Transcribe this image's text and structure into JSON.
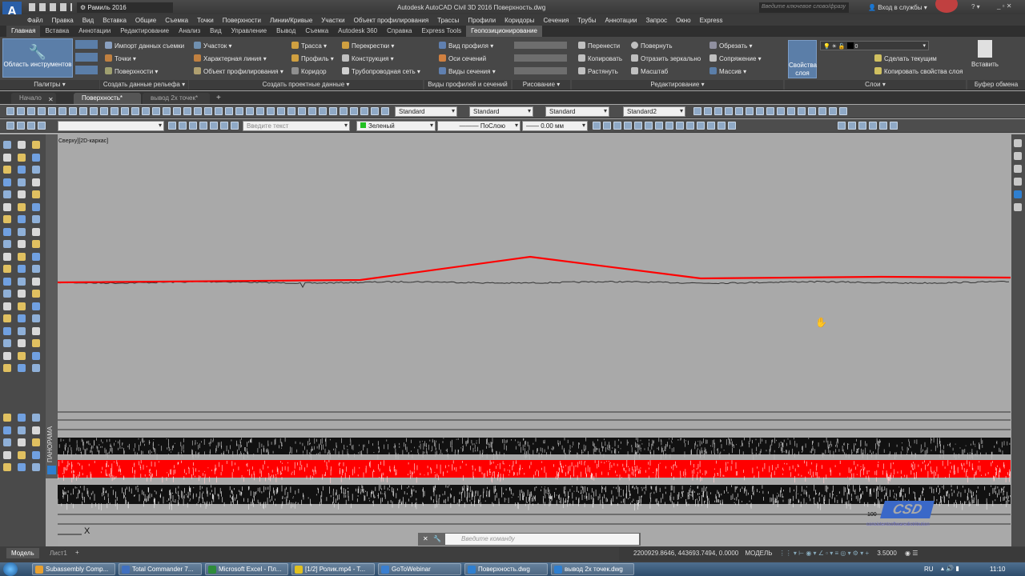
{
  "titlebar": {
    "workspace": "Рамиль 2016",
    "title": "Autodesk AutoCAD Civil 3D 2016   Поверхность.dwg",
    "search_placeholder": "Введите ключевое слово/фразу",
    "signin": "Вход в службы"
  },
  "menu": [
    "Файл",
    "Правка",
    "Вид",
    "Вставка",
    "Общие",
    "Съемка",
    "Точки",
    "Поверхности",
    "Линии/Кривые",
    "Участки",
    "Объект профилирования",
    "Трассы",
    "Профили",
    "Коридоры",
    "Сечения",
    "Трубы",
    "Аннотации",
    "Запрос",
    "Окно",
    "Express"
  ],
  "ribbon_tabs": [
    "Главная",
    "Вставка",
    "Аннотации",
    "Редактирование",
    "Анализ",
    "Вид",
    "Управление",
    "Вывод",
    "Съемка",
    "Autodesk 360",
    "Справка",
    "Express Tools",
    "Геопозиционирование"
  ],
  "ribbon": {
    "tool_area": "Область инструментов",
    "palettes": "Палитры ▾",
    "terrain": {
      "items": [
        "Импорт данных съемки",
        "Точки ▾",
        "Поверхности ▾"
      ],
      "label": "Создать данные рельефа ▾"
    },
    "design": {
      "items": [
        "Участок ▾",
        "Характерная линия ▾",
        "Объект профилирования ▾",
        "Трасса ▾",
        "Профиль ▾",
        "Коридор",
        "Перекрестки ▾",
        "Конструкция ▾",
        "Трубопроводная сеть ▾"
      ],
      "label": "Создать проектные данные ▾"
    },
    "profiles": {
      "items": [
        "Вид профиля ▾",
        "Оси сечений",
        "Виды сечения ▾"
      ],
      "label": "Виды профилей и сечений"
    },
    "draw": {
      "label": "Рисование ▾"
    },
    "modify": {
      "items": [
        "Перенести",
        "Копировать",
        "Растянуть",
        "Повернуть",
        "Отразить зеркально",
        "Масштаб",
        "Обрезать ▾",
        "Сопряжение ▾",
        "Массив ▾"
      ],
      "label": "Редактирование ▾"
    },
    "layers": {
      "props": "Свойства слоя",
      "current_layer": "0",
      "make_current": "Сделать текущим",
      "copy_props": "Копировать свойства слоя",
      "label": "Слои ▾"
    },
    "clipboard": {
      "paste": "Вставить",
      "label": "Буфер обмена"
    }
  },
  "file_tabs": [
    "Начало",
    "Поверхность*",
    "вывод 2х точек*"
  ],
  "toolbar": {
    "styles": [
      "Standard",
      "Standard",
      "Standard",
      "Standard2"
    ],
    "text_placeholder": "Введите текст",
    "color": "Зеленый",
    "linetype": "ПоСлою",
    "lineweight": "0.00 мм"
  },
  "viewport_label": "Сверху][2D-каркас]",
  "panorama": "ПАНОРАМА",
  "drawing": {
    "scale_text": "100",
    "logo": "CSD",
    "logo_sub": "consistentsoftwaredistribution",
    "axis_x": "X"
  },
  "command": {
    "placeholder": "Введите команду"
  },
  "layout_tabs": [
    "Модель",
    "Лист1"
  ],
  "status": {
    "coords": "2200929.8646, 443693.7494, 0.0000",
    "space": "МОДЕЛЬ",
    "scale": "3.5000"
  },
  "taskbar": {
    "items": [
      {
        "label": "Subassembly Comp...",
        "color": "#e8a030"
      },
      {
        "label": "Total Commander 7...",
        "color": "#4070c0"
      },
      {
        "label": "Microsoft Excel - Пл...",
        "color": "#2e8b3a"
      },
      {
        "label": "[1/2] Ролик.mp4 - T...",
        "color": "#e0c020"
      },
      {
        "label": "GoToWebinar",
        "color": "#3a7fd0"
      },
      {
        "label": "Поверхность.dwg",
        "color": "#2f7fd0"
      },
      {
        "label": "вывод 2х точек.dwg",
        "color": "#2f7fd0"
      }
    ],
    "lang": "RU",
    "clock": "11:10"
  },
  "colors": {
    "accent": "#5b7ea8",
    "profile_red": "#ff0000",
    "canvas": "#a9a9a9"
  }
}
